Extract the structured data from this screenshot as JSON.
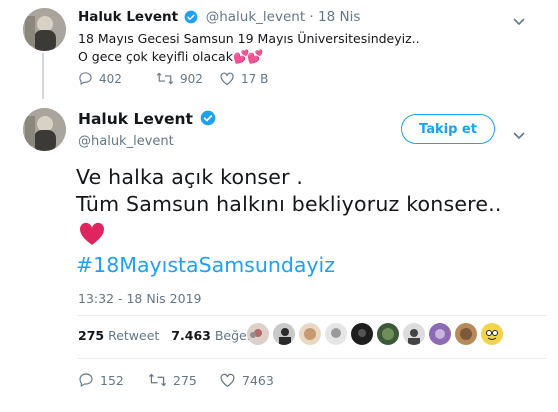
{
  "parent_tweet": {
    "name": "Haluk Levent",
    "handle": "@haluk_levent",
    "separator": "·",
    "time": "18 Nis",
    "text_line1": "18 Mayıs Gecesi Samsun 19 Mayıs Üniversitesindeyiz..",
    "text_line2": "O gece çok keyifli olacak",
    "emoji": "💕💕",
    "replies": "402",
    "retweets": "902",
    "likes": "17 B",
    "menu_icon": "chevron-down-icon"
  },
  "main_tweet": {
    "name": "Haluk Levent",
    "handle": "@haluk_levent",
    "follow_label": "Takip et",
    "text_line1": "Ve halka açık konser .",
    "text_line2": "Tüm Samsun halkını bekliyoruz konsere..",
    "hashtag": "#18MayıstaSamsundayiz",
    "timestamp": "13:32 - 18 Nis 2019",
    "retweet_count": "275",
    "retweet_label": "Retweet",
    "like_count": "7.463",
    "like_label": "Beğeni",
    "action_replies": "152",
    "action_retweets": "275",
    "action_likes": "7463"
  },
  "colors": {
    "accent": "#1da1f2",
    "heart": "#e0245e",
    "muted": "#657786",
    "divider": "#e6ecf0"
  }
}
